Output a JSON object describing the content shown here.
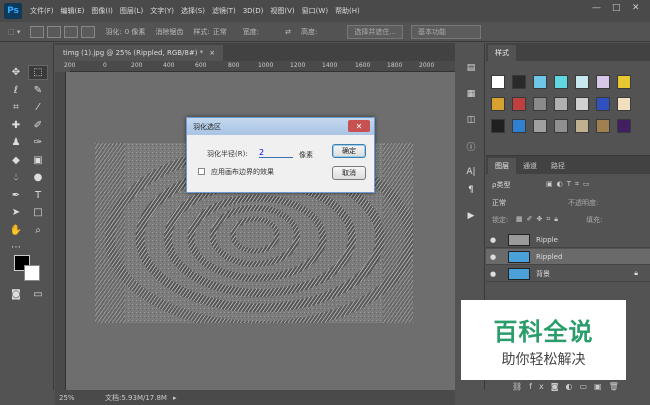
{
  "app": {
    "logo": "Ps"
  },
  "menu": [
    "文件(F)",
    "编辑(E)",
    "图像(I)",
    "图层(L)",
    "文字(Y)",
    "选择(S)",
    "滤镜(T)",
    "3D(D)",
    "视图(V)",
    "窗口(W)",
    "帮助(H)"
  ],
  "window_controls": {
    "minimize": "—",
    "maximize": "□",
    "close": "✕"
  },
  "options": {
    "feather_label": "羽化:",
    "feather_value": "0 像素",
    "antialias_label": "消除锯齿",
    "style_label": "样式:",
    "style_value": "正常",
    "width_label": "宽度:",
    "height_label": "高度:",
    "select_mask_button": "选择并遮住...",
    "workspace": "基本功能"
  },
  "document": {
    "tab_title": "timg (1).jpg @ 25% (Rippled, RGB/8#) *",
    "tab_close": "×",
    "ruler_ticks": [
      "200",
      "0",
      "200",
      "400",
      "600",
      "800",
      "1000",
      "1200",
      "1400",
      "1600",
      "1800",
      "2000"
    ],
    "zoom": "25%",
    "doc_info": "文档:5.93M/17.8M"
  },
  "dialog": {
    "title": "羽化选区",
    "radius_label": "羽化半径(R):",
    "radius_value": "2",
    "unit": "像素",
    "checkbox_label": "应用画布边界的效果",
    "ok": "确定",
    "cancel": "取消"
  },
  "styles_panel": {
    "tab": "样式",
    "swatch_colors": [
      "#ffffff",
      "#2a2a2a",
      "#6ec7e6",
      "#5fd6e0",
      "#c8e8f0",
      "#d8c8e8",
      "#e8c830",
      "#d8a030",
      "#c04040",
      "#8a8a8a",
      "#b0b0b0",
      "#d0d0d0",
      "#3050c0",
      "#f0e0c0",
      "#202020",
      "#3080d0",
      "#a0a0a0",
      "#909090",
      "#c0b090",
      "#a08050",
      "#402060"
    ]
  },
  "layers_panel": {
    "tabs": [
      "图层",
      "通道",
      "路径"
    ],
    "kind_label": "ρ类型",
    "blend_mode": "正常",
    "opacity_label": "不透明度:",
    "lock_label": "锁定:",
    "fill_label": "填充:",
    "layers": [
      {
        "name": "Ripple",
        "selected": false,
        "thumb": "#9a9a9a"
      },
      {
        "name": "Rippled",
        "selected": true,
        "thumb": "#4aa0d8"
      },
      {
        "name": "背景",
        "selected": false,
        "thumb": "#4aa0d8",
        "locked": true
      }
    ]
  },
  "watermark": {
    "line1": "百科全说",
    "line2": "助你轻松解决"
  }
}
